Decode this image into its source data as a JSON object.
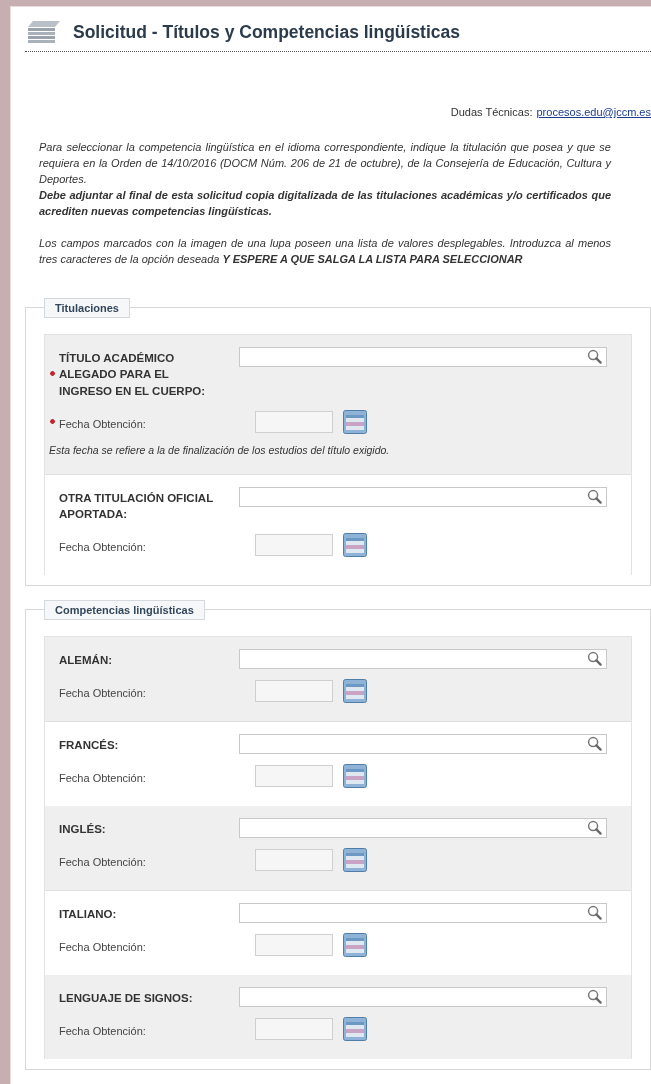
{
  "title": "Solicitud - Títulos y Competencias lingüísticas",
  "contact": {
    "label": "Dudas Técnicas:",
    "link": "procesos.edu@jccm.es"
  },
  "intro": [
    {
      "kind": "italic",
      "text": "Para seleccionar la competencia lingüística en el idioma correspondiente, indique la titulación que posea y que se requiera en la Orden de 14/10/2016 (DOCM Núm. 206 de 21 de octubre), de la Consejería de Educación, Cultura y Deportes."
    },
    {
      "kind": "bold",
      "text": "Debe adjuntar al final de esta solicitud copia digitalizada de las titulaciones académicas y/o certificados que acrediten nuevas competencias lingüísticas."
    },
    {
      "kind": "gap",
      "text": "Los campos marcados con la imagen de una lupa poseen una lista de valores desplegables. Introduzca al menos tres caracteres de la opción deseada **Y ESPERE A QUE SALGA LA LISTA PARA SELECCIONAR**"
    }
  ],
  "sections": [
    {
      "legend": "Titulaciones",
      "groups": [
        {
          "label": "TÍTULO ACADÉMICO ALEGADO PARA EL INGRESO EN EL CUERPO:",
          "required": true,
          "date_label": "Fecha Obtención:",
          "date_required": true,
          "note": "Esta fecha se refiere a la de finalización de los estudios del título exigido."
        },
        {
          "label": "OTRA TITULACIÓN OFICIAL APORTADA:",
          "required": false,
          "date_label": "Fecha Obtención:",
          "date_required": false
        }
      ]
    },
    {
      "legend": "Competencias lingüísticas",
      "groups": [
        {
          "label": "ALEMÁN:",
          "required": false,
          "date_label": "Fecha Obtención:",
          "date_required": false
        },
        {
          "label": "FRANCÉS:",
          "required": false,
          "date_label": "Fecha Obtención:",
          "date_required": false
        },
        {
          "label": "INGLÉS:",
          "required": false,
          "date_label": "Fecha Obtención:",
          "date_required": false
        },
        {
          "label": "ITALIANO:",
          "required": false,
          "date_label": "Fecha Obtención:",
          "date_required": false
        },
        {
          "label": "LENGUAJE DE SIGNOS:",
          "required": false,
          "date_label": "Fecha Obtención:",
          "date_required": false
        }
      ]
    }
  ]
}
